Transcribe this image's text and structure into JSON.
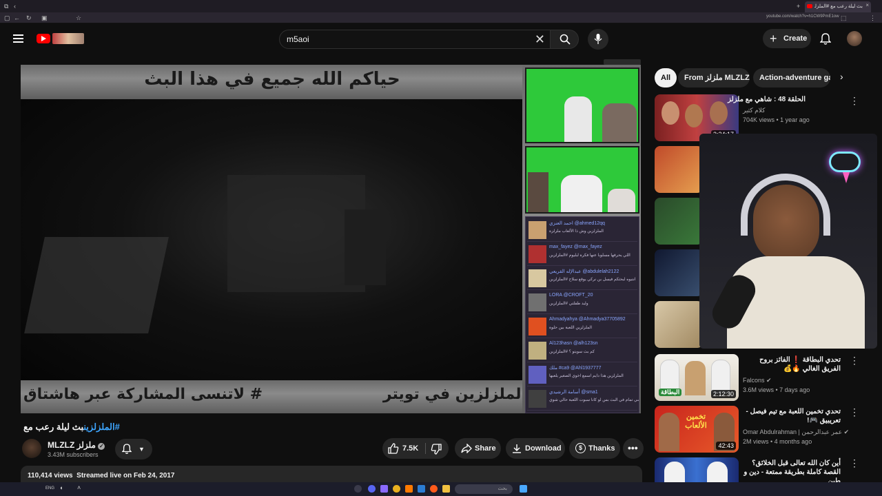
{
  "browser": {
    "tab_title": "بث ليلة رعب مع #الملزلزين",
    "url": "youtube.com/watch?v=h1CW9PmE1ow"
  },
  "header": {
    "search_value": "m5aoi",
    "create_label": "Create"
  },
  "video": {
    "overlay_top": "حياكم الله جميع في هذا البث",
    "overlay_bottom_left": "# لاتنسى المشاركة عبر هاشتاق",
    "overlay_bottom_right": "الملزلزين في تويتر",
    "title_hashtag": "#الملزلزين",
    "title_text": "بث ليلة رعب مع",
    "chat": [
      {
        "name": "احمد العنزي @ahmed12qq",
        "text": "الملزلزين وش ذا الألعاب ملزلزة",
        "color": "#c9a070"
      },
      {
        "name": "max_fayez @max_fayez",
        "text": "اللي يحرفها مسلوبا عنها فكرة لبليوم #الملزلزين",
        "color": "#b03030"
      },
      {
        "name": "عبدالإله القريعي @abdulelah2122",
        "text": "انتبوه لبحثكم فيسل بن نركي يوقع سلاح #الملزلزين",
        "color": "#d8c8a0"
      },
      {
        "name": "LORA @CROFT_20",
        "text": "وليد طفلتي #الملزلزين",
        "color": "#707070"
      },
      {
        "name": "Ahmadyahya @Ahmadya37705892",
        "text": "الملزلزين اللعبة بين حلوة",
        "color": "#e05020"
      },
      {
        "name": "Al123hasn @alh123sn",
        "text": "كم بث سويتو ؟ #الملزلزين",
        "color": "#c0b080"
      },
      {
        "name": "ملك #ca9 @Ahl1937777",
        "text": "الملزلزين هذا دايم اسمع اخوي الصغير يلعبها",
        "color": "#6060c0"
      },
      {
        "name": "أسامة الرشيدي @sma1",
        "text": "الملزلزين هلا بمودلك كل شي تمام في البث بس لو كانا سبوت اللعبة حالي شوي",
        "color": "#404040"
      }
    ]
  },
  "channel": {
    "name": "MLZLZ ملزلز",
    "subscribers": "3.43M subscribers"
  },
  "actions": {
    "likes": "7.5K",
    "share": "Share",
    "download": "Download",
    "thanks": "Thanks"
  },
  "description": {
    "stats": "110,414 views  Streamed live on Feb 24, 2017"
  },
  "chips": [
    "All",
    "From ملزلز MLZLZ",
    "Action-adventure gam"
  ],
  "sidebar": [
    {
      "title": "الحلقة 48 : شاهي مع ملزلز",
      "channel": "كلام كثير",
      "meta": "704K views • 1 year ago",
      "duration": "3:24:17"
    },
    {
      "title": "تحدي البطاقة ❗ الفائز بروح الفريق الغالي 🔥💰",
      "channel": "Falcons ✔",
      "meta": "3.6M views • 7 days ago",
      "duration": "2:12:30",
      "thumb_text": "البطاقة"
    },
    {
      "title": "تحدي تخمين اللعبة مع تيم فيصل - تعريبيق 🎮!",
      "channel": "Omar Abdulrahman | عمر عبدالرحمن ✔",
      "meta": "2M views • 4 months ago",
      "duration": "42:43",
      "thumb_text": "تخمين الألعاب"
    },
    {
      "title": "أين كان الله تعالى قبل الخلائق؟ القصة كاملة بطريقة ممتعة - دين و طين",
      "channel": "",
      "meta": "",
      "duration": ""
    }
  ],
  "taskbar": {
    "time": "",
    "lang": "ENG",
    "search_placeholder": "بحث"
  },
  "colors": {
    "accent_red": "#ff0000",
    "bg": "#0f0f0f",
    "link_blue": "#3ea6ff"
  }
}
